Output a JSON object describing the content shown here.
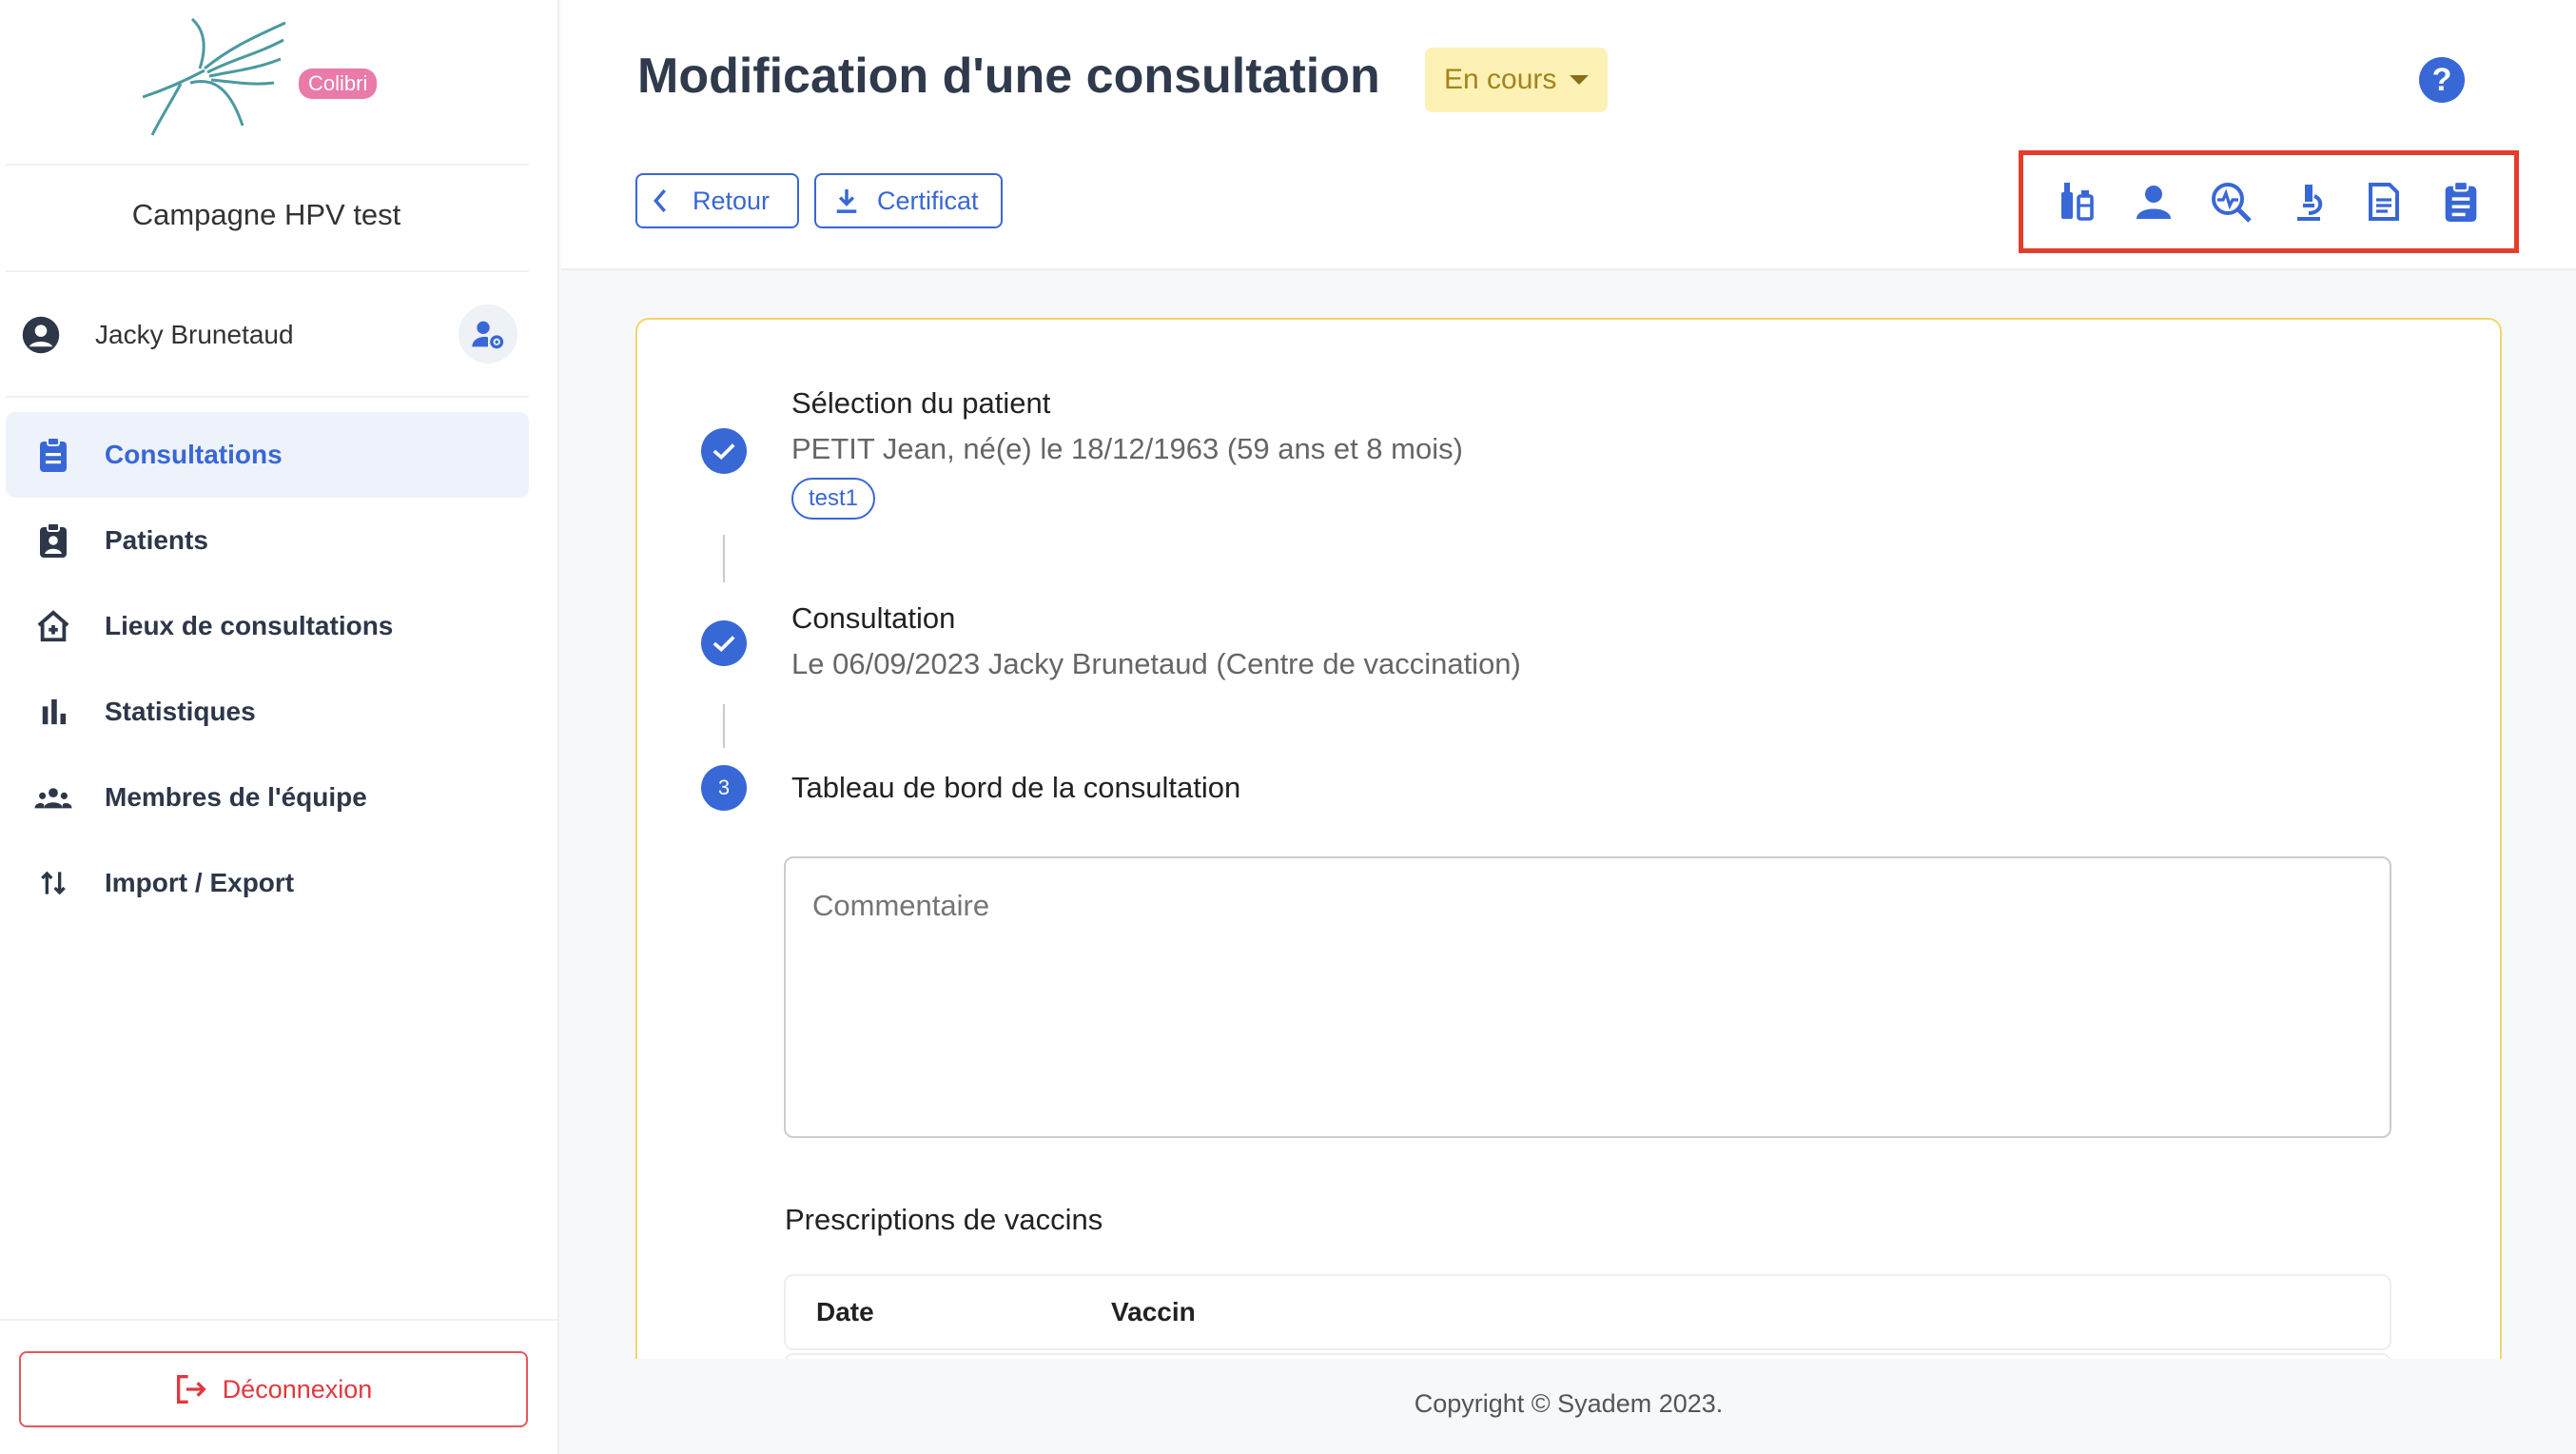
{
  "brand": {
    "badge": "Colibri"
  },
  "sidebar": {
    "campaign": "Campagne HPV test",
    "user_name": "Jacky Brunetaud",
    "items": [
      {
        "label": "Consultations",
        "icon": "clipboard-icon",
        "active": true
      },
      {
        "label": "Patients",
        "icon": "patient-badge-icon",
        "active": false
      },
      {
        "label": "Lieux de consultations",
        "icon": "home-plus-icon",
        "active": false
      },
      {
        "label": "Statistiques",
        "icon": "bar-chart-icon",
        "active": false
      },
      {
        "label": "Membres de l'équipe",
        "icon": "team-icon",
        "active": false
      },
      {
        "label": "Import / Export",
        "icon": "swap-vertical-icon",
        "active": false
      }
    ],
    "logout_label": "Déconnexion"
  },
  "header": {
    "title": "Modification d'une consultation",
    "status": "En cours",
    "back_label": "Retour",
    "certificate_label": "Certificat",
    "toolbar_icons": [
      "vaccine-icon",
      "person-icon",
      "search-health-icon",
      "microscope-icon",
      "document-icon",
      "clipboard-icon"
    ]
  },
  "steps": [
    {
      "title": "Sélection du patient",
      "desc": "PETIT Jean, né(e) le 18/12/1963 (59 ans et 8 mois)",
      "tag": "test1",
      "done": true
    },
    {
      "title": "Consultation",
      "desc": "Le 06/09/2023 Jacky Brunetaud (Centre de vaccination)",
      "done": true
    },
    {
      "title": "Tableau de bord de la consultation",
      "number": "3",
      "done": false
    }
  ],
  "comment_placeholder": "Commentaire",
  "prescriptions": {
    "title": "Prescriptions de vaccins",
    "columns": [
      "Date",
      "Vaccin"
    ]
  },
  "footer": "Copyright © Syadem 2023.",
  "colors": {
    "primary": "#3867d6",
    "status_bg": "#fdf1b6",
    "danger": "#e0393e",
    "highlight": "#e33d2b"
  }
}
